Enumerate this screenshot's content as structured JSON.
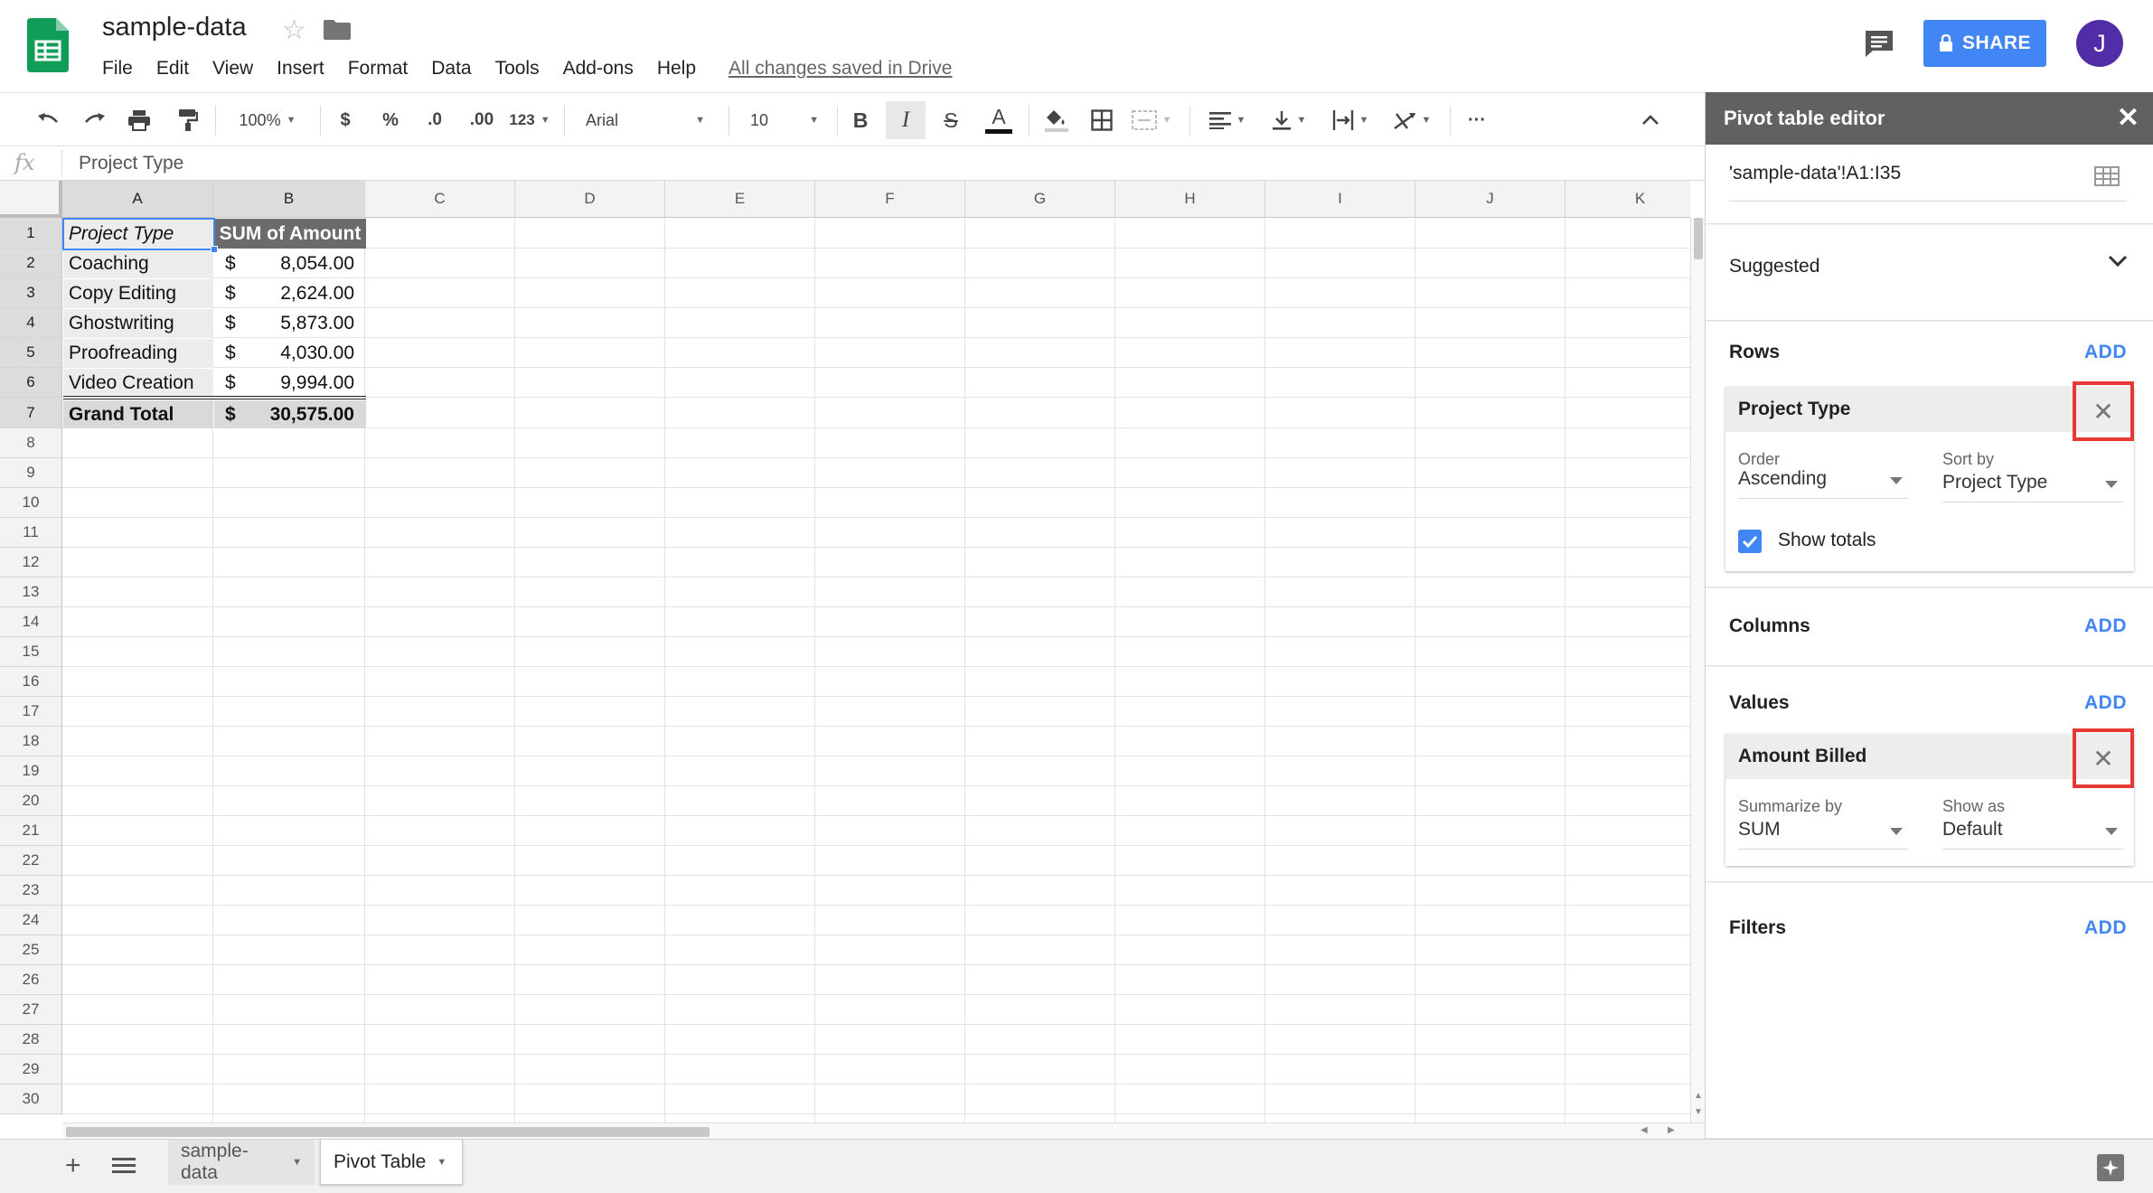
{
  "app": {
    "doc_title": "sample-data",
    "menu": [
      "File",
      "Edit",
      "View",
      "Insert",
      "Format",
      "Data",
      "Tools",
      "Add-ons",
      "Help"
    ],
    "saved_status": "All changes saved in Drive",
    "share_label": "SHARE",
    "avatar_initial": "J"
  },
  "toolbar": {
    "zoom": "100%",
    "currency": "$",
    "percent": "%",
    "dec_decrease": ".0",
    "dec_increase": ".00",
    "more_formats": "123",
    "font": "Arial",
    "font_size": "10",
    "bold": "B",
    "italic": "I",
    "strike": "S",
    "text_color": "A",
    "more": "···"
  },
  "formula": {
    "fx": "fx",
    "value": "Project Type"
  },
  "grid": {
    "columns": [
      "A",
      "B",
      "C",
      "D",
      "E",
      "F",
      "G",
      "H",
      "I",
      "J",
      "K"
    ],
    "rows": [
      "1",
      "2",
      "3",
      "4",
      "5",
      "6",
      "7",
      "8",
      "9",
      "10",
      "11",
      "12",
      "13",
      "14",
      "15",
      "16",
      "17",
      "18",
      "19",
      "20",
      "21",
      "22",
      "23",
      "24",
      "25",
      "26",
      "27",
      "28",
      "29",
      "30"
    ],
    "pivot_header": [
      "Project Type",
      "SUM of  Amount"
    ],
    "pivot_rows": [
      {
        "type": "Coaching",
        "currency": "$",
        "amount": "8,054.00"
      },
      {
        "type": "Copy Editing",
        "currency": "$",
        "amount": "2,624.00"
      },
      {
        "type": "Ghostwriting",
        "currency": "$",
        "amount": "5,873.00"
      },
      {
        "type": "Proofreading",
        "currency": "$",
        "amount": "4,030.00"
      },
      {
        "type": "Video Creation",
        "currency": "$",
        "amount": "9,994.00"
      }
    ],
    "grand_total": {
      "label": "Grand Total",
      "currency": "$",
      "amount": "30,575.00"
    }
  },
  "sheets": {
    "tabs": [
      "sample-data",
      "Pivot Table"
    ],
    "active": "Pivot Table"
  },
  "pivot_editor": {
    "title": "Pivot table editor",
    "range": "'sample-data'!A1:I35",
    "suggested": "Suggested",
    "add_label": "ADD",
    "rows": {
      "title": "Rows",
      "field": "Project Type",
      "order_label": "Order",
      "order_value": "Ascending",
      "sort_label": "Sort by",
      "sort_value": "Project Type",
      "show_totals": "Show totals"
    },
    "columns": {
      "title": "Columns"
    },
    "values": {
      "title": "Values",
      "field": "Amount Billed",
      "summarize_label": "Summarize by",
      "summarize_value": "SUM",
      "show_as_label": "Show as",
      "show_as_value": "Default"
    },
    "filters": {
      "title": "Filters"
    }
  },
  "colors": {
    "accent": "#4285f4",
    "sheets_green": "#0f9d58",
    "highlight_red": "#e53935",
    "avatar": "#512da8"
  }
}
